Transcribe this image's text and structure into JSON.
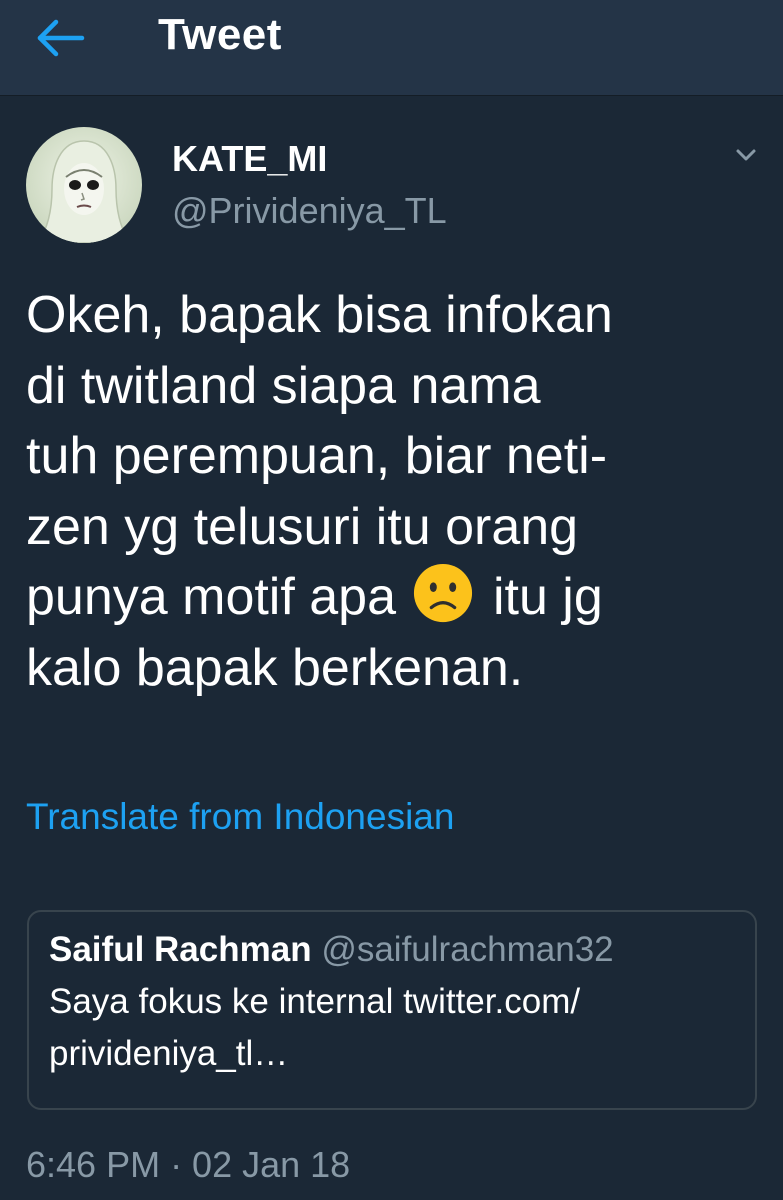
{
  "header": {
    "title": "Tweet",
    "back_icon": "back-arrow-icon",
    "accent_color": "#1da1f2"
  },
  "tweet": {
    "display_name": "KATE_MI",
    "handle": "@Privideniya_TL",
    "text_lines": [
      "Okeh, bapak bisa infokan",
      "di twitland siapa nama",
      "tuh perempuan, biar neti-",
      "zen yg telusuri itu orang",
      "punya motif apa",
      "itu jg",
      "kalo bapak berkenan."
    ],
    "emoji": "slightly-frowning-face",
    "translate_label": "Translate from Indonesian",
    "timestamp": "6:46 PM · 02 Jan 18"
  },
  "quoted_tweet": {
    "name": "Saiful Rachman",
    "handle": "@saifulrachman32",
    "text_lines": [
      "Saya fokus ke internal twitter.com/",
      "privideniya_tl…"
    ]
  },
  "colors": {
    "background": "#1b2836",
    "header": "#243447",
    "secondary_text": "#8899a6",
    "border": "#38444d"
  }
}
